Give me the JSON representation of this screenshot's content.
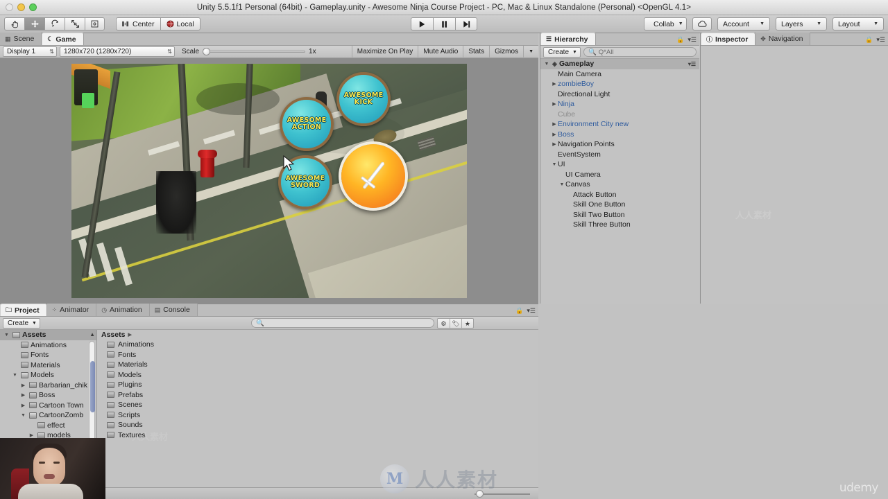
{
  "window": {
    "title": "Unity 5.5.1f1 Personal (64bit) - Gameplay.unity - Awesome Ninja Course Project - PC, Mac & Linux Standalone (Personal) <OpenGL 4.1>"
  },
  "toolbar": {
    "tools": [
      {
        "name": "hand-tool",
        "icon": "hand"
      },
      {
        "name": "move-tool",
        "icon": "move"
      },
      {
        "name": "rotate-tool",
        "icon": "rotate"
      },
      {
        "name": "scale-tool",
        "icon": "scale"
      },
      {
        "name": "rect-tool",
        "icon": "rect"
      }
    ],
    "pivot_label": "Center",
    "space_label": "Local",
    "play_label": "Play",
    "pause_label": "Pause",
    "step_label": "Step",
    "collab_label": "Collab",
    "cloud_label": "Cloud",
    "account_label": "Account",
    "layers_label": "Layers",
    "layout_label": "Layout"
  },
  "game_panel": {
    "tabs": [
      {
        "label": "Scene",
        "icon": "grid-icon",
        "active": false
      },
      {
        "label": "Game",
        "icon": "moon-icon",
        "active": true
      }
    ],
    "display": "Display 1",
    "resolution": "1280x720 (1280x720)",
    "scale_label": "Scale",
    "scale_value": "1x",
    "maximize_label": "Maximize On Play",
    "mute_label": "Mute Audio",
    "stats_label": "Stats",
    "gizmos_label": "Gizmos"
  },
  "game_ui": {
    "buttons": [
      {
        "name": "awesome-kick-button",
        "line1": "AWESOME",
        "line2": "KICK"
      },
      {
        "name": "awesome-action-button",
        "line1": "AWESOME",
        "line2": "ACTION"
      },
      {
        "name": "awesome-sword-button",
        "line1": "AWESOME",
        "line2": "SWORD"
      }
    ],
    "attack_button": "attack-button"
  },
  "hierarchy": {
    "tab_label": "Hierarchy",
    "create_label": "Create",
    "search_placeholder": "Q*All",
    "items": [
      {
        "label": "Gameplay",
        "depth": 0,
        "arrow": "down",
        "icon": "unity-icon",
        "style": "scene",
        "selected": true
      },
      {
        "label": "Main Camera",
        "depth": 1,
        "arrow": "none",
        "icon": "",
        "style": "normal",
        "selected": false
      },
      {
        "label": "zombieBoy",
        "depth": 1,
        "arrow": "right",
        "icon": "",
        "style": "prefab",
        "selected": false
      },
      {
        "label": "Directional Light",
        "depth": 1,
        "arrow": "none",
        "icon": "",
        "style": "normal",
        "selected": false
      },
      {
        "label": "Ninja",
        "depth": 1,
        "arrow": "right",
        "icon": "",
        "style": "prefab",
        "selected": false
      },
      {
        "label": "Cube",
        "depth": 1,
        "arrow": "none",
        "icon": "",
        "style": "dim",
        "selected": false
      },
      {
        "label": "Environment City new",
        "depth": 1,
        "arrow": "right",
        "icon": "",
        "style": "prefab",
        "selected": false
      },
      {
        "label": "Boss",
        "depth": 1,
        "arrow": "right",
        "icon": "",
        "style": "prefab",
        "selected": false
      },
      {
        "label": "Navigation Points",
        "depth": 1,
        "arrow": "right",
        "icon": "",
        "style": "normal",
        "selected": false
      },
      {
        "label": "EventSystem",
        "depth": 1,
        "arrow": "none",
        "icon": "",
        "style": "normal",
        "selected": false
      },
      {
        "label": "UI",
        "depth": 1,
        "arrow": "down",
        "icon": "",
        "style": "normal",
        "selected": false
      },
      {
        "label": "UI Camera",
        "depth": 2,
        "arrow": "none",
        "icon": "",
        "style": "normal",
        "selected": false
      },
      {
        "label": "Canvas",
        "depth": 2,
        "arrow": "down",
        "icon": "",
        "style": "normal",
        "selected": false
      },
      {
        "label": "Attack Button",
        "depth": 3,
        "arrow": "none",
        "icon": "",
        "style": "normal",
        "selected": false
      },
      {
        "label": "Skill One Button",
        "depth": 3,
        "arrow": "none",
        "icon": "",
        "style": "normal",
        "selected": false
      },
      {
        "label": "Skill Two Button",
        "depth": 3,
        "arrow": "none",
        "icon": "",
        "style": "normal",
        "selected": false
      },
      {
        "label": "Skill Three Button",
        "depth": 3,
        "arrow": "none",
        "icon": "",
        "style": "normal",
        "selected": false
      }
    ]
  },
  "inspector": {
    "tabs": [
      {
        "label": "Inspector",
        "icon": "info-icon",
        "active": true
      },
      {
        "label": "Navigation",
        "icon": "nav-icon",
        "active": false
      }
    ]
  },
  "project": {
    "tabs": [
      {
        "label": "Project",
        "icon": "folder-icon",
        "active": true
      },
      {
        "label": "Animator",
        "icon": "animator-icon",
        "active": false
      },
      {
        "label": "Animation",
        "icon": "clock-icon",
        "active": false
      },
      {
        "label": "Console",
        "icon": "console-icon",
        "active": false
      }
    ],
    "create_label": "Create",
    "search_placeholder": "",
    "tree_root": "Assets",
    "tree": [
      {
        "label": "Assets",
        "depth": 0,
        "arrow": "down",
        "selected": true
      },
      {
        "label": "Animations",
        "depth": 1,
        "arrow": "none",
        "selected": false
      },
      {
        "label": "Fonts",
        "depth": 1,
        "arrow": "none",
        "selected": false
      },
      {
        "label": "Materials",
        "depth": 1,
        "arrow": "none",
        "selected": false
      },
      {
        "label": "Models",
        "depth": 1,
        "arrow": "down",
        "selected": false
      },
      {
        "label": "Barbarian_chik",
        "depth": 2,
        "arrow": "right",
        "selected": false
      },
      {
        "label": "Boss",
        "depth": 2,
        "arrow": "right",
        "selected": false
      },
      {
        "label": "Cartoon Town",
        "depth": 2,
        "arrow": "right",
        "selected": false
      },
      {
        "label": "CartoonZomb",
        "depth": 2,
        "arrow": "down",
        "selected": false
      },
      {
        "label": "effect",
        "depth": 3,
        "arrow": "none",
        "selected": false
      },
      {
        "label": "models",
        "depth": 3,
        "arrow": "right",
        "selected": false
      }
    ],
    "breadcrumb": "Assets",
    "files": [
      {
        "label": "Animations"
      },
      {
        "label": "Fonts"
      },
      {
        "label": "Materials"
      },
      {
        "label": "Models"
      },
      {
        "label": "Plugins"
      },
      {
        "label": "Prefabs"
      },
      {
        "label": "Scenes"
      },
      {
        "label": "Scripts"
      },
      {
        "label": "Sounds"
      },
      {
        "label": "Textures"
      }
    ]
  },
  "watermarks": {
    "center_text": "人人素材",
    "center_logo": "M",
    "corner_text": "udemy"
  },
  "colors": {
    "panel_bg": "#c3c3c3",
    "toolbar_bg": "#cfcfcf",
    "prefab_blue": "#2e5b9e",
    "ui_button_cyan": "#3fc2cf",
    "attack_orange": "#ffb524",
    "label_yellow": "#ffe84a"
  }
}
